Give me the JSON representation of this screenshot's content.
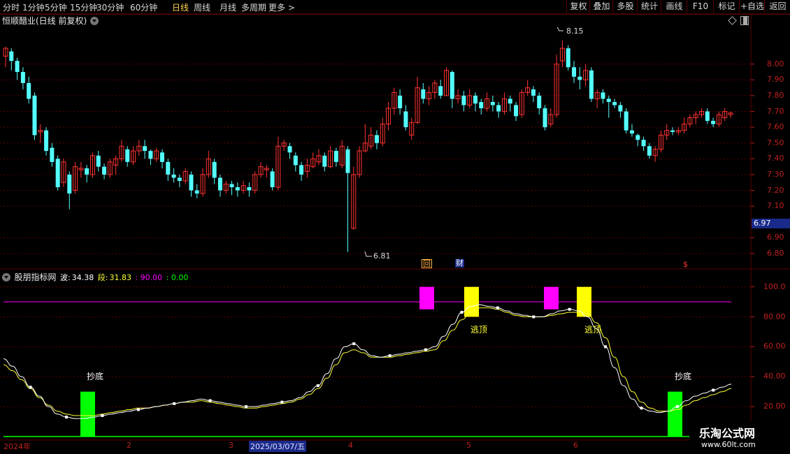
{
  "toolbar": {
    "periods": [
      "分时",
      "1分钟",
      "5分钟",
      "15分钟",
      "30分钟",
      "60分钟",
      "日线",
      "周线",
      "月线",
      "多周期",
      "更多 >"
    ],
    "active_period": "日线",
    "buttons": [
      "复权",
      "叠加",
      "多股",
      "统计",
      "画线",
      "F10",
      "+自选",
      "返回"
    ],
    "tag_button": "标记"
  },
  "stock": {
    "title": "恒顺醋业(日线 前复权)",
    "high_label": "8.15",
    "low_label": "6.81",
    "current_price": "6.97"
  },
  "price_axis": [
    "8.00",
    "7.90",
    "7.80",
    "7.70",
    "7.60",
    "7.50",
    "7.40",
    "7.30",
    "7.20",
    "7.10",
    "6.90",
    "6.80"
  ],
  "indicator": {
    "name": "股朋指标网",
    "wave_label": "波:",
    "wave_value": "34.38",
    "seg_label": "段:",
    "seg_value": "31.83",
    "upper": ": 90.00",
    "lower": ": 0.00",
    "axis": [
      "100.0",
      "80.00",
      "60.00",
      "40.00",
      "20.00"
    ],
    "signals": {
      "bottom": "抄底",
      "top": "逃顶"
    }
  },
  "markers": {
    "review": "回",
    "finance": "财",
    "dollar": "$"
  },
  "dates": {
    "year": "2024年",
    "m2": "2",
    "m3": "3",
    "selected": "2025/03/07/五",
    "m4": "4",
    "m5": "5",
    "m6": "6"
  },
  "watermark": {
    "line1": "乐淘公式网",
    "line2": "www.60lt.com"
  },
  "colors": {
    "up": "#ff3232",
    "down": "#54ffff",
    "bg": "#000000",
    "grid": "#5a0000",
    "wave": "#ffffff",
    "seg": "#ffff33",
    "pink": "#ff00ff",
    "yellow": "#ffff00",
    "green": "#00ff00"
  },
  "chart_data": {
    "type": "candlestick",
    "candles": [
      [
        8.05,
        8.1,
        8.11,
        7.98
      ],
      [
        8.08,
        8.02,
        8.1,
        7.96
      ],
      [
        8.02,
        7.95,
        8.04,
        7.9
      ],
      [
        7.95,
        7.88,
        7.98,
        7.84
      ],
      [
        7.88,
        7.78,
        7.92,
        7.75
      ],
      [
        7.8,
        7.55,
        7.82,
        7.52
      ],
      [
        7.57,
        7.58,
        7.62,
        7.5
      ],
      [
        7.58,
        7.45,
        7.6,
        7.42
      ],
      [
        7.47,
        7.38,
        7.5,
        7.35
      ],
      [
        7.4,
        7.22,
        7.42,
        7.2
      ],
      [
        7.25,
        7.38,
        7.4,
        7.22
      ],
      [
        7.3,
        7.18,
        7.32,
        7.08
      ],
      [
        7.2,
        7.35,
        7.38,
        7.18
      ],
      [
        7.33,
        7.34,
        7.38,
        7.28
      ],
      [
        7.34,
        7.3,
        7.36,
        7.25
      ],
      [
        7.3,
        7.42,
        7.44,
        7.28
      ],
      [
        7.42,
        7.35,
        7.45,
        7.32
      ],
      [
        7.35,
        7.3,
        7.37,
        7.27
      ],
      [
        7.3,
        7.38,
        7.4,
        7.28
      ],
      [
        7.36,
        7.4,
        7.42,
        7.3
      ],
      [
        7.4,
        7.48,
        7.52,
        7.38
      ],
      [
        7.46,
        7.38,
        7.48,
        7.35
      ],
      [
        7.38,
        7.45,
        7.48,
        7.36
      ],
      [
        7.45,
        7.48,
        7.52,
        7.42
      ],
      [
        7.48,
        7.45,
        7.52,
        7.4
      ],
      [
        7.45,
        7.4,
        7.46,
        7.36
      ],
      [
        7.4,
        7.45,
        7.47,
        7.38
      ],
      [
        7.44,
        7.38,
        7.46,
        7.34
      ],
      [
        7.38,
        7.3,
        7.4,
        7.26
      ],
      [
        7.3,
        7.28,
        7.34,
        7.25
      ],
      [
        7.28,
        7.26,
        7.3,
        7.22
      ],
      [
        7.26,
        7.32,
        7.34,
        7.24
      ],
      [
        7.3,
        7.2,
        7.32,
        7.16
      ],
      [
        7.2,
        7.18,
        7.24,
        7.15
      ],
      [
        7.18,
        7.3,
        7.34,
        7.16
      ],
      [
        7.3,
        7.4,
        7.45,
        7.28
      ],
      [
        7.38,
        7.28,
        7.4,
        7.24
      ],
      [
        7.28,
        7.2,
        7.3,
        7.16
      ],
      [
        7.2,
        7.24,
        7.26,
        7.18
      ],
      [
        7.24,
        7.22,
        7.26,
        7.17
      ],
      [
        7.22,
        7.2,
        7.25,
        7.16
      ],
      [
        7.2,
        7.23,
        7.26,
        7.18
      ],
      [
        7.22,
        7.2,
        7.25,
        7.16
      ],
      [
        7.2,
        7.3,
        7.32,
        7.18
      ],
      [
        7.3,
        7.35,
        7.38,
        7.28
      ],
      [
        7.33,
        7.34,
        7.36,
        7.28
      ],
      [
        7.32,
        7.22,
        7.34,
        7.2
      ],
      [
        7.22,
        7.48,
        7.54,
        7.2
      ],
      [
        7.48,
        7.5,
        7.52,
        7.45
      ],
      [
        7.48,
        7.44,
        7.5,
        7.4
      ],
      [
        7.42,
        7.36,
        7.44,
        7.32
      ],
      [
        7.36,
        7.3,
        7.38,
        7.26
      ],
      [
        7.32,
        7.36,
        7.4,
        7.28
      ],
      [
        7.35,
        7.4,
        7.44,
        7.34
      ],
      [
        7.38,
        7.42,
        7.46,
        7.36
      ],
      [
        7.42,
        7.35,
        7.44,
        7.32
      ],
      [
        7.35,
        7.45,
        7.48,
        7.34
      ],
      [
        7.45,
        7.38,
        7.47,
        7.35
      ],
      [
        7.36,
        7.48,
        7.52,
        7.34
      ],
      [
        7.46,
        7.31,
        7.48,
        6.81
      ],
      [
        6.96,
        7.3,
        7.35,
        6.95
      ],
      [
        7.3,
        7.45,
        7.48,
        7.28
      ],
      [
        7.45,
        7.5,
        7.62,
        7.44
      ],
      [
        7.48,
        7.55,
        7.6,
        7.46
      ],
      [
        7.55,
        7.5,
        7.58,
        7.46
      ],
      [
        7.5,
        7.62,
        7.66,
        7.48
      ],
      [
        7.62,
        7.72,
        7.76,
        7.58
      ],
      [
        7.72,
        7.82,
        7.85,
        7.68
      ],
      [
        7.8,
        7.72,
        7.84,
        7.68
      ],
      [
        7.7,
        7.6,
        7.74,
        7.58
      ],
      [
        7.55,
        7.63,
        7.66,
        7.52
      ],
      [
        7.63,
        7.85,
        7.92,
        7.62
      ],
      [
        7.84,
        7.78,
        7.88,
        7.75
      ],
      [
        7.78,
        7.82,
        7.86,
        7.74
      ],
      [
        7.82,
        7.88,
        7.9,
        7.78
      ],
      [
        7.86,
        7.8,
        7.9,
        7.78
      ],
      [
        7.8,
        7.96,
        7.98,
        7.8
      ],
      [
        7.95,
        7.78,
        7.96,
        7.72
      ],
      [
        7.78,
        7.8,
        7.84,
        7.75
      ],
      [
        7.8,
        7.74,
        7.83,
        7.7
      ],
      [
        7.74,
        7.8,
        7.84,
        7.72
      ],
      [
        7.8,
        7.75,
        7.82,
        7.7
      ],
      [
        7.76,
        7.72,
        7.78,
        7.68
      ],
      [
        7.72,
        7.78,
        7.82,
        7.7
      ],
      [
        7.76,
        7.74,
        7.8,
        7.7
      ],
      [
        7.74,
        7.7,
        7.76,
        7.66
      ],
      [
        7.7,
        7.78,
        7.82,
        7.68
      ],
      [
        7.78,
        7.75,
        7.8,
        7.7
      ],
      [
        7.74,
        7.67,
        7.76,
        7.64
      ],
      [
        7.68,
        7.82,
        7.84,
        7.66
      ],
      [
        7.82,
        7.85,
        7.9,
        7.8
      ],
      [
        7.84,
        7.8,
        7.86,
        7.76
      ],
      [
        7.8,
        7.72,
        7.82,
        7.68
      ],
      [
        7.72,
        7.6,
        7.74,
        7.58
      ],
      [
        7.62,
        7.68,
        7.72,
        7.6
      ],
      [
        7.68,
        8.0,
        8.06,
        7.66
      ],
      [
        8.02,
        8.1,
        8.15,
        7.98
      ],
      [
        8.1,
        7.98,
        8.12,
        7.96
      ],
      [
        7.98,
        7.92,
        8.02,
        7.88
      ],
      [
        7.92,
        7.9,
        7.98,
        7.84
      ],
      [
        7.9,
        7.96,
        8.0,
        7.86
      ],
      [
        7.96,
        7.78,
        7.98,
        7.76
      ],
      [
        7.78,
        7.82,
        7.84,
        7.72
      ],
      [
        7.82,
        7.78,
        7.84,
        7.75
      ],
      [
        7.78,
        7.76,
        7.8,
        7.66
      ],
      [
        7.76,
        7.74,
        7.78,
        7.72
      ],
      [
        7.74,
        7.7,
        7.76,
        7.66
      ],
      [
        7.7,
        7.58,
        7.72,
        7.56
      ],
      [
        7.58,
        7.56,
        7.62,
        7.54
      ],
      [
        7.55,
        7.52,
        7.56,
        7.48
      ],
      [
        7.52,
        7.48,
        7.54,
        7.45
      ],
      [
        7.48,
        7.42,
        7.5,
        7.4
      ],
      [
        7.42,
        7.46,
        7.48,
        7.38
      ],
      [
        7.46,
        7.55,
        7.58,
        7.44
      ],
      [
        7.55,
        7.58,
        7.62,
        7.52
      ],
      [
        7.58,
        7.57,
        7.6,
        7.55
      ],
      [
        7.57,
        7.58,
        7.6,
        7.55
      ],
      [
        7.58,
        7.62,
        7.66,
        7.56
      ],
      [
        7.62,
        7.66,
        7.68,
        7.6
      ],
      [
        7.66,
        7.68,
        7.7,
        7.62
      ],
      [
        7.68,
        7.7,
        7.72,
        7.66
      ],
      [
        7.7,
        7.64,
        7.72,
        7.62
      ],
      [
        7.64,
        7.62,
        7.66,
        7.6
      ],
      [
        7.62,
        7.68,
        7.7,
        7.6
      ],
      [
        7.66,
        7.7,
        7.72,
        7.64
      ],
      [
        7.68,
        7.69,
        7.7,
        7.66
      ]
    ],
    "price_range": [
      6.76,
      8.22
    ],
    "indicator_range": [
      0,
      105
    ],
    "wave": [
      52,
      47,
      40,
      33,
      27,
      20,
      15,
      13,
      12,
      12,
      13,
      14,
      15,
      16,
      17,
      18,
      19,
      20,
      21,
      22,
      23,
      24,
      25,
      24,
      23,
      22,
      21,
      20,
      20,
      21,
      22,
      23,
      24,
      26,
      30,
      34,
      42,
      52,
      60,
      62,
      58,
      54,
      53,
      54,
      55,
      56,
      57,
      58,
      60,
      67,
      75,
      83,
      87,
      88,
      87,
      86,
      84,
      82,
      81,
      80,
      80,
      82,
      84,
      85,
      84,
      80,
      72,
      60,
      46,
      34,
      25,
      19,
      17,
      16,
      17,
      20,
      24,
      27,
      29,
      31,
      33,
      35
    ],
    "seg": [
      48,
      44,
      38,
      32,
      26,
      21,
      17,
      15,
      14,
      14,
      14,
      15,
      16,
      17,
      18,
      19,
      19,
      20,
      21,
      22,
      23,
      23,
      24,
      23,
      22,
      21,
      20,
      19,
      19,
      20,
      21,
      22,
      23,
      25,
      28,
      32,
      39,
      48,
      56,
      58,
      56,
      53,
      53,
      53,
      54,
      55,
      56,
      57,
      58,
      64,
      71,
      78,
      83,
      86,
      86,
      85,
      83,
      81,
      80,
      80,
      80,
      81,
      82,
      83,
      83,
      82,
      76,
      66,
      53,
      40,
      30,
      23,
      19,
      17,
      17,
      18,
      21,
      24,
      26,
      28,
      30,
      32
    ]
  }
}
